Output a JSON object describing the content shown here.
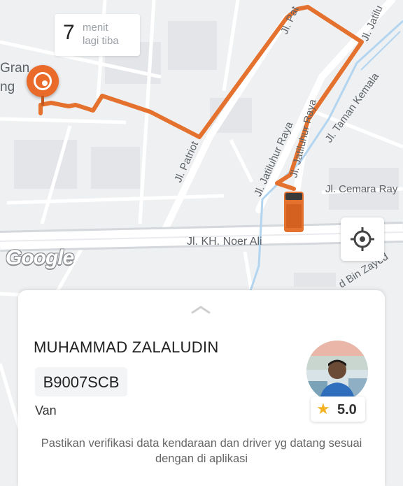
{
  "map": {
    "eta": {
      "value": "7",
      "line1": "menit",
      "line2": "lagi tiba"
    },
    "place_label_1": "Gran",
    "place_label_2": "ng",
    "roads": {
      "patriot_label": "Jl. Patriot",
      "pat_top_label": "Jl. Pat",
      "jatiluhur_top_label": "Jl. Jatilu",
      "taman_kemala_label": "Jl. Taman Kemala",
      "jatiluhur_raya_label_1": "Jl. Jatiluhur Raya",
      "jatiluhur_raya_label_2": "Jl. Jatiluhur Raya",
      "cemara_label": "Jl. Cemara Ray",
      "noer_ali_label": "Jl. KH. Noer Ali",
      "zayed_label": "d Bin Zayed"
    },
    "google_logo": "Google",
    "route_color": "#e4712d",
    "vehicle_icon": "van-icon",
    "destination_icon": "pickup-pin-icon",
    "locate_icon": "crosshair-icon"
  },
  "sheet": {
    "handle_icon": "chevron-up-icon",
    "driver_name": "MUHAMMAD ZALALUDIN",
    "plate": "B9007SCB",
    "vehicle_type": "Van",
    "avatar_icon": "driver-avatar",
    "rating_icon": "star-icon",
    "rating": "5.0",
    "note": "Pastikan verifikasi data kendaraan dan driver yg datang sesuai dengan di aplikasi"
  }
}
